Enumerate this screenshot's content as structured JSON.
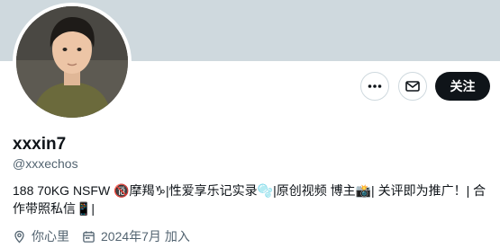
{
  "profile": {
    "display_name": "xxxin7",
    "handle": "@xxxechos",
    "bio_line1": "188 70KG NSFW 🔞摩羯♑|性爱享乐记实录🫧|原创视频 博主📸| 关评即为推广！| 合",
    "bio_line2": "作带照私信📱|",
    "location": "你心里",
    "joined": "2024年7月 加入"
  },
  "actions": {
    "follow_label": "关注",
    "more_icon": "more-horizontal-icon",
    "message_icon": "envelope-icon"
  },
  "colors": {
    "banner": "#cfd9de",
    "primary_text": "#0f1419",
    "secondary_text": "#536471",
    "follow_bg": "#0f1419"
  }
}
